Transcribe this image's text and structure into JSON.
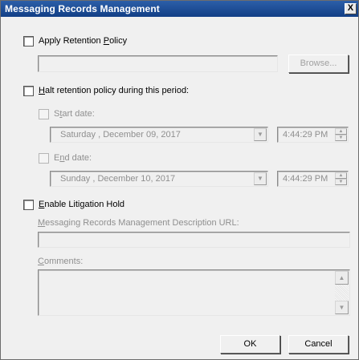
{
  "window": {
    "title": "Messaging Records Management",
    "close_glyph": "X"
  },
  "retention": {
    "checkbox_label_pre": "Apply Retention ",
    "checkbox_label_key": "P",
    "checkbox_label_post": "olicy",
    "policy_value": "",
    "browse_label": "Browse..."
  },
  "halt": {
    "label_key": "H",
    "label_post": "alt retention policy during this period:",
    "start": {
      "label_pre": "S",
      "label_key": "t",
      "label_post": "art date:",
      "date": "Saturday   , December 09, 2017",
      "time": "4:44:29 PM"
    },
    "end": {
      "label_pre": "E",
      "label_key": "n",
      "label_post": "d date:",
      "date": "Sunday    , December 10, 2017",
      "time": "4:44:29 PM"
    }
  },
  "litigation": {
    "label_key": "E",
    "label_post": "nable Litigation Hold",
    "url_label_key": "M",
    "url_label_post": "essaging Records Management Description URL:",
    "url_value": "",
    "comments_label_key": "C",
    "comments_label_post": "omments:",
    "comments_value": ""
  },
  "footer": {
    "ok_label": "OK",
    "cancel_label": "Cancel"
  },
  "icons": {
    "dropdown": "chevron-down-icon",
    "spin_up": "chevron-up-icon",
    "spin_down": "chevron-down-icon",
    "scroll_up": "scroll-up-icon",
    "scroll_down": "scroll-down-icon"
  }
}
